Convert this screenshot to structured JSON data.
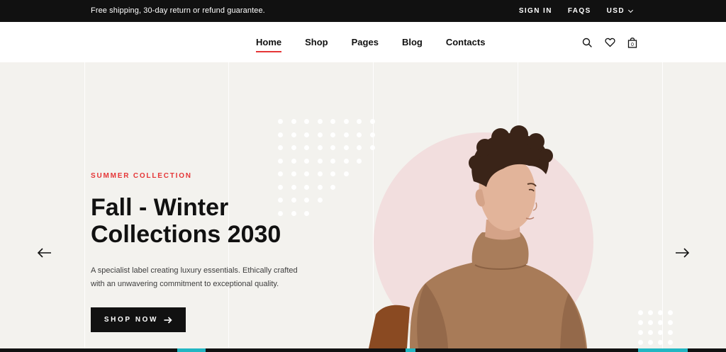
{
  "topbar": {
    "promo": "Free shipping, 30-day return or refund guarantee.",
    "sign_in": "SIGN IN",
    "faqs": "FAQS",
    "currency": "USD"
  },
  "nav": {
    "items": [
      {
        "label": "Home",
        "active": true
      },
      {
        "label": "Shop",
        "active": false
      },
      {
        "label": "Pages",
        "active": false
      },
      {
        "label": "Blog",
        "active": false
      },
      {
        "label": "Contacts",
        "active": false
      }
    ]
  },
  "header_icons": [
    "search-icon",
    "heart-icon",
    "bag-icon"
  ],
  "cart_count": "0",
  "hero": {
    "eyebrow": "SUMMER COLLECTION",
    "title_line1": "Fall - Winter",
    "title_line2": "Collections 2030",
    "description_line1": "A specialist label creating luxury essentials. Ethically crafted",
    "description_line2": "with an unwavering commitment to exceptional quality.",
    "cta": "SHOP NOW"
  },
  "colors": {
    "accent": "#e53637",
    "dark": "#111111",
    "hero_bg": "#f3f2ee",
    "circle": "#f2dede"
  }
}
